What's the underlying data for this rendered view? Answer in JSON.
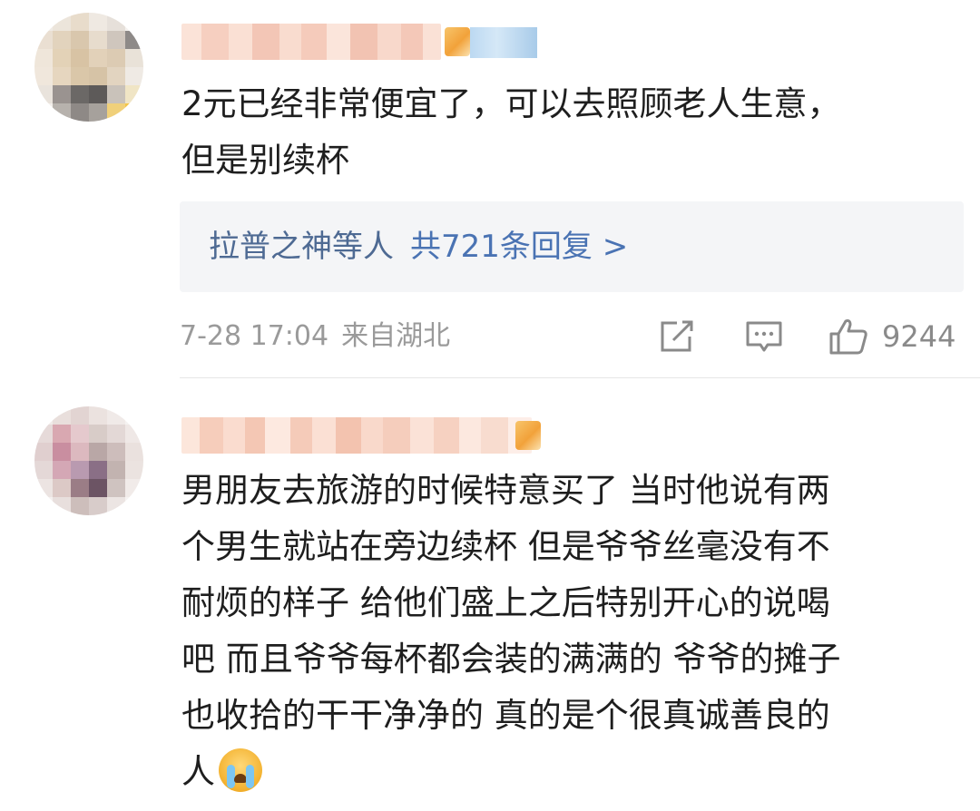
{
  "comments": [
    {
      "text_lines": [
        "2元已经非常便宜了，可以去照顾老人生意，",
        "但是别续杯"
      ],
      "replies": {
        "names": "拉普之神等人",
        "count": "共721条回复 >"
      },
      "time": "7-28 17:04",
      "location": "来自湖北",
      "likes": "9244"
    },
    {
      "text_lines": [
        "男朋友去旅游的时候特意买了 当时他说有两",
        "个男生就站在旁边续杯 但是爷爷丝毫没有不",
        "耐烦的样子 给他们盛上之后特别开心的说喝",
        "吧 而且爷爷每杯都会装的满满的 爷爷的摊子",
        "也收拾的干干净净的 真的是个很真诚善良的",
        "人"
      ],
      "trailing_emoji": "crying-face-emoji"
    }
  ],
  "colors": {
    "link": "#4a73b3",
    "meta": "#9a9a9a",
    "reply_bg": "#f4f5f7",
    "text": "#1e1e1e"
  }
}
